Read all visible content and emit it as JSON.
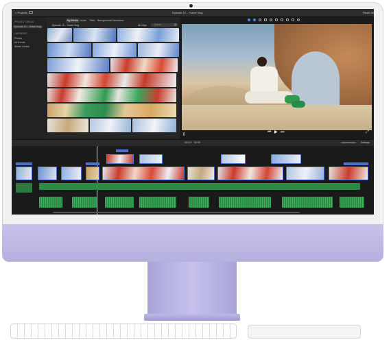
{
  "app": {
    "project_button": "< Projects",
    "window_title": "Episode 12 – Travel Vlog",
    "reset_all": "Reset All"
  },
  "sidebar": {
    "section_project_media": "PROJECT MEDIA",
    "project_item": "Episode 12 – Travel Vlog",
    "section_libraries": "LIBRARIES",
    "items": [
      "Photos",
      "All Events",
      "iMovie Library"
    ]
  },
  "browser": {
    "tabs": [
      "My Media",
      "Audio",
      "Titles",
      "Backgrounds",
      "Transitions"
    ],
    "active_tab": "My Media",
    "episode_label": "Episode 12 – Travel Vlog",
    "filter_label": "All Clips",
    "search_placeholder": "Search"
  },
  "viewer": {
    "timecode": "00:10",
    "divider": "/",
    "duration": "02:30",
    "settings_label": "Settings"
  },
  "colors": {
    "clip_outline": "#4f6bd6",
    "audio_track": "#2e8b45",
    "imac_purple": "#b5b0df"
  },
  "icons": {
    "play": "play-icon",
    "skip_back": "skip-back-icon",
    "skip_forward": "skip-forward-icon",
    "fullscreen": "fullscreen-icon",
    "camera": "camera-icon"
  }
}
